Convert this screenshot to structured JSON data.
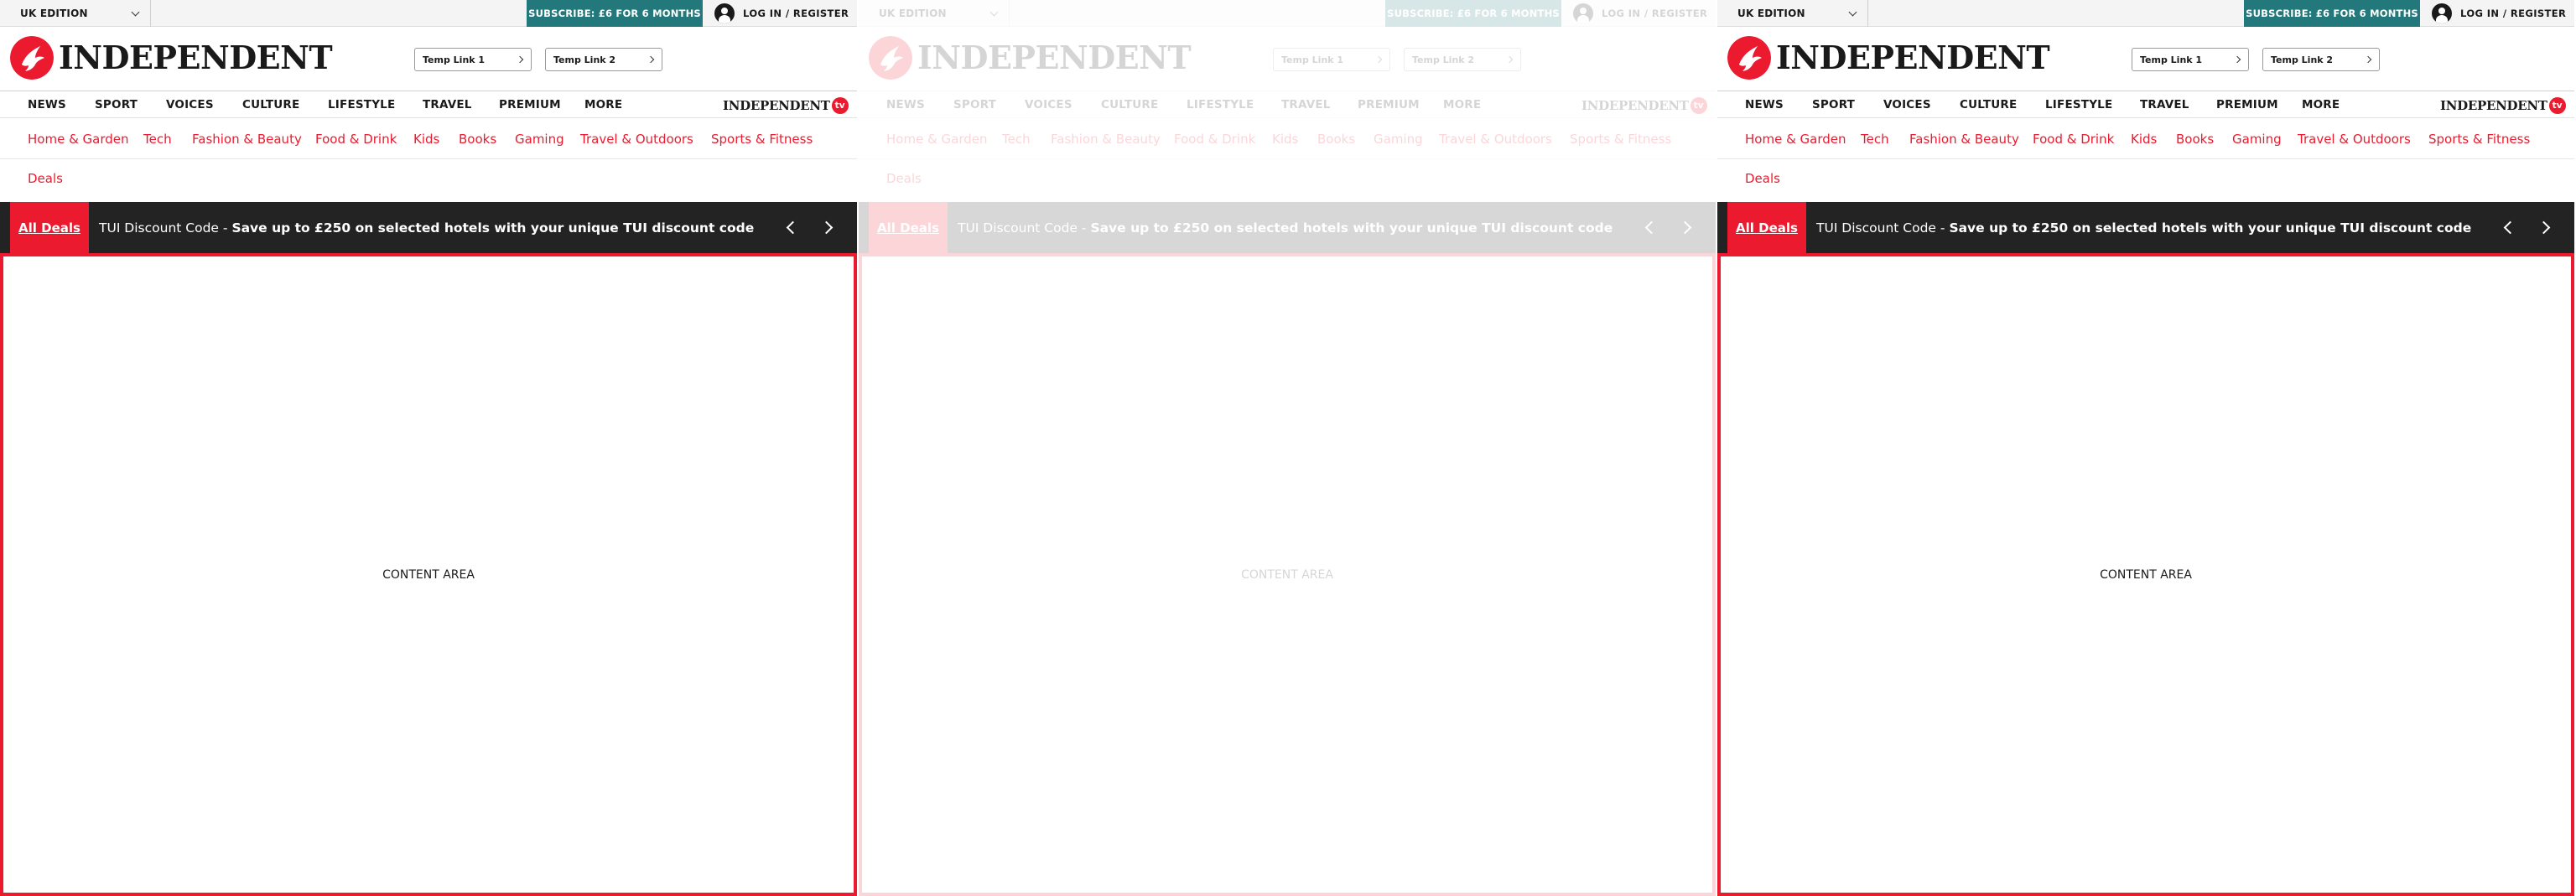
{
  "colors": {
    "brand_red": "#ec1a2e",
    "subscribe_teal": "#22787a",
    "deals_dark": "#232323",
    "text_dark": "#1a1a1a"
  },
  "topbar": {
    "edition_label": "UK EDITION",
    "subscribe_label": "SUBSCRIBE: £6 FOR 6 MONTHS",
    "login_label": "LOG IN / REGISTER"
  },
  "masthead": {
    "logo_text": "INDEPENDENT",
    "temp_link_1": "Temp Link 1",
    "temp_link_2": "Temp Link 2"
  },
  "main_nav": {
    "items": [
      {
        "label": "NEWS"
      },
      {
        "label": "SPORT"
      },
      {
        "label": "VOICES"
      },
      {
        "label": "CULTURE"
      },
      {
        "label": "LIFESTYLE"
      },
      {
        "label": "TRAVEL"
      },
      {
        "label": "PREMIUM"
      },
      {
        "label": "MORE"
      }
    ],
    "tv_logo_text": "INDEPENDENT",
    "tv_badge": "tv"
  },
  "sub_nav": {
    "items": [
      {
        "label": "Home & Garden"
      },
      {
        "label": "Tech"
      },
      {
        "label": "Fashion & Beauty"
      },
      {
        "label": "Food & Drink"
      },
      {
        "label": "Kids"
      },
      {
        "label": "Books"
      },
      {
        "label": "Gaming"
      },
      {
        "label": "Travel & Outdoors"
      },
      {
        "label": "Sports & Fitness"
      },
      {
        "label": "Deals"
      }
    ]
  },
  "deals_bar": {
    "all_deals_label": "All Deals",
    "deal_prefix": "TUI Discount Code - ",
    "deal_highlight": "Save up to £250 on selected hotels with your unique TUI discount code"
  },
  "content": {
    "placeholder": "CONTENT AREA"
  }
}
